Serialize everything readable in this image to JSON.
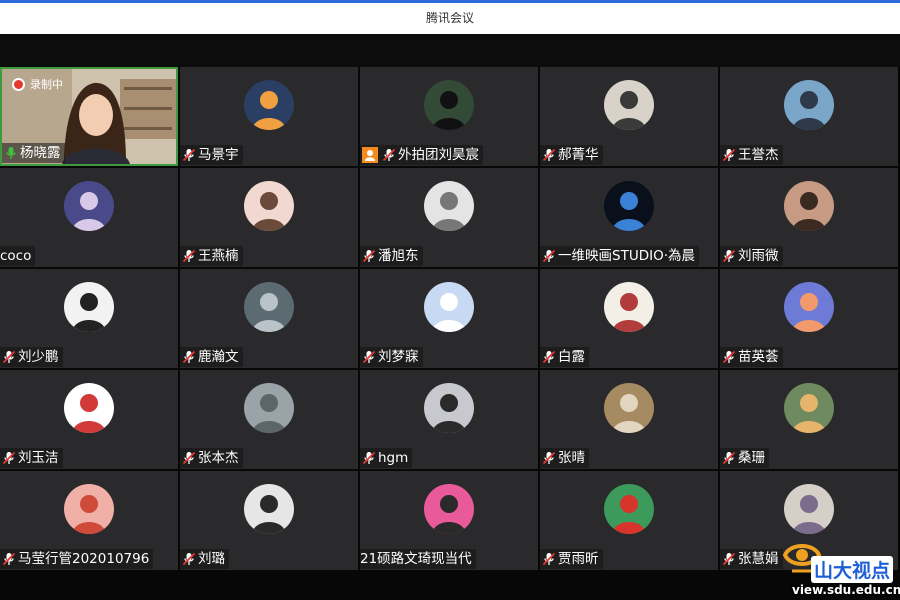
{
  "window": {
    "title": "腾讯会议"
  },
  "recording": {
    "label": "录制中"
  },
  "participants": [
    {
      "name": "杨晓露",
      "mic": "on",
      "presenter": true
    },
    {
      "name": "马景宇",
      "mic": "muted",
      "avatar_bg": "#2b3e63",
      "avatar_fg": "#f0a040"
    },
    {
      "name": "外拍团刘昊宸",
      "mic": "muted",
      "host": true,
      "avatar_bg": "#324a36",
      "avatar_fg": "#111111"
    },
    {
      "name": "郝菁华",
      "mic": "muted",
      "avatar_bg": "#d9d2c8",
      "avatar_fg": "#3a3a3a"
    },
    {
      "name": "王誉杰",
      "mic": "muted",
      "avatar_bg": "#7aa6c9",
      "avatar_fg": "#2e3a4a"
    },
    {
      "name": "coco",
      "mic": "none",
      "avatar_bg": "#4a4a8a",
      "avatar_fg": "#d8c9e8"
    },
    {
      "name": "王燕楠",
      "mic": "muted",
      "avatar_bg": "#f1d9d2",
      "avatar_fg": "#6b4a3a"
    },
    {
      "name": "潘旭东",
      "mic": "muted",
      "avatar_bg": "#e4e4e4",
      "avatar_fg": "#777777"
    },
    {
      "name": "一维映画STUDIO·為晨",
      "mic": "muted",
      "avatar_bg": "#0a0f1c",
      "avatar_fg": "#3b82d6"
    },
    {
      "name": "刘雨微",
      "mic": "muted",
      "avatar_bg": "#c79a84",
      "avatar_fg": "#3a2a22"
    },
    {
      "name": "刘少鹏",
      "mic": "muted",
      "avatar_bg": "#f2f2f2",
      "avatar_fg": "#222222"
    },
    {
      "name": "鹿瀚文",
      "mic": "muted",
      "avatar_bg": "#5c6a72",
      "avatar_fg": "#b9c3c8"
    },
    {
      "name": "刘梦寐",
      "mic": "muted",
      "avatar_bg": "#c8daf3",
      "avatar_fg": "#ffffff"
    },
    {
      "name": "白露",
      "mic": "muted",
      "avatar_bg": "#f3efe6",
      "avatar_fg": "#b23b3b"
    },
    {
      "name": "苗英荟",
      "mic": "muted",
      "avatar_bg": "#6d7bd6",
      "avatar_fg": "#f29a6b"
    },
    {
      "name": "刘玉洁",
      "mic": "muted",
      "avatar_bg": "#ffffff",
      "avatar_fg": "#d23a3a"
    },
    {
      "name": "张本杰",
      "mic": "muted",
      "avatar_bg": "#9aa3a8",
      "avatar_fg": "#5c6568"
    },
    {
      "name": "hgm",
      "mic": "muted",
      "avatar_bg": "#c8c8cf",
      "avatar_fg": "#2a2a2a"
    },
    {
      "name": "张晴",
      "mic": "muted",
      "avatar_bg": "#a58a62",
      "avatar_fg": "#e2d6c0"
    },
    {
      "name": "桑珊",
      "mic": "muted",
      "avatar_bg": "#6f8a5e",
      "avatar_fg": "#e6b46a"
    },
    {
      "name": "马莹行管202010796",
      "mic": "muted",
      "avatar_bg": "#f0b0a8",
      "avatar_fg": "#d04a3a"
    },
    {
      "name": "刘璐",
      "mic": "muted",
      "avatar_bg": "#e6e6e6",
      "avatar_fg": "#2a2a2a"
    },
    {
      "name": "21硕路文琦现当代",
      "mic": "none",
      "avatar_bg": "#e95a9a",
      "avatar_fg": "#2a2a2a"
    },
    {
      "name": "贾雨昕",
      "mic": "muted",
      "avatar_bg": "#3c9a5a",
      "avatar_fg": "#d8342c"
    },
    {
      "name": "张慧娟",
      "mic": "muted",
      "avatar_bg": "#d6cfc7",
      "avatar_fg": "#7a6c8a"
    }
  ],
  "watermark": {
    "logo_text": "山大视点",
    "url": "view.sdu.edu.cn"
  }
}
